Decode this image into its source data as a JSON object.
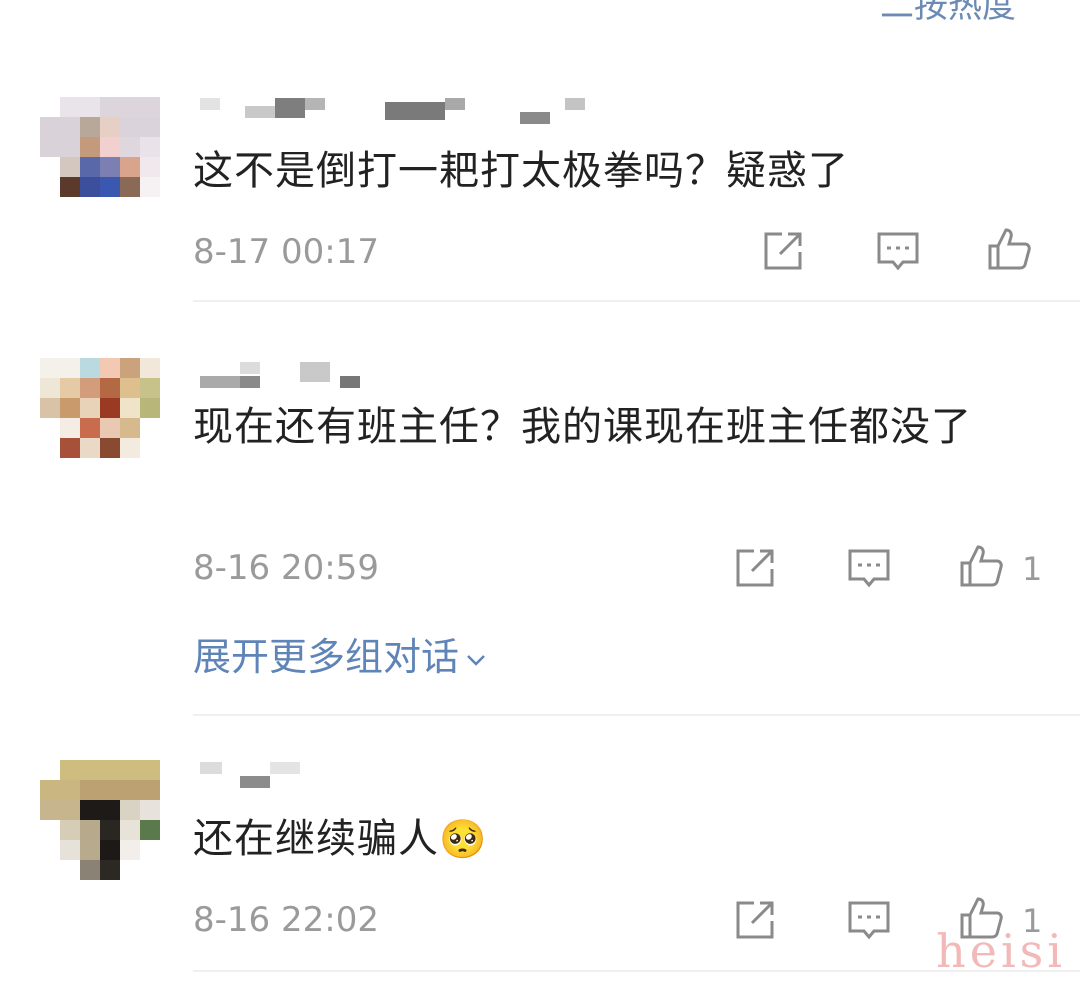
{
  "header": {
    "sort_label": "二按热度"
  },
  "comments": [
    {
      "text": "这不是倒打一耙打太极拳吗？疑惑了",
      "time": "8-17 00:17",
      "likes": ""
    },
    {
      "text": "现在还有班主任？我的课现在班主任都没了",
      "time": "8-16 20:59",
      "likes": "1",
      "expand_label": "展开更多组对话"
    },
    {
      "text": "还在继续骗人",
      "emoji": "🥺",
      "time": "8-16 22:02",
      "likes": "1"
    }
  ],
  "watermark": "heisi",
  "colors": {
    "link": "#5f84b7",
    "meta": "#9a9a9a",
    "text": "#222222"
  }
}
